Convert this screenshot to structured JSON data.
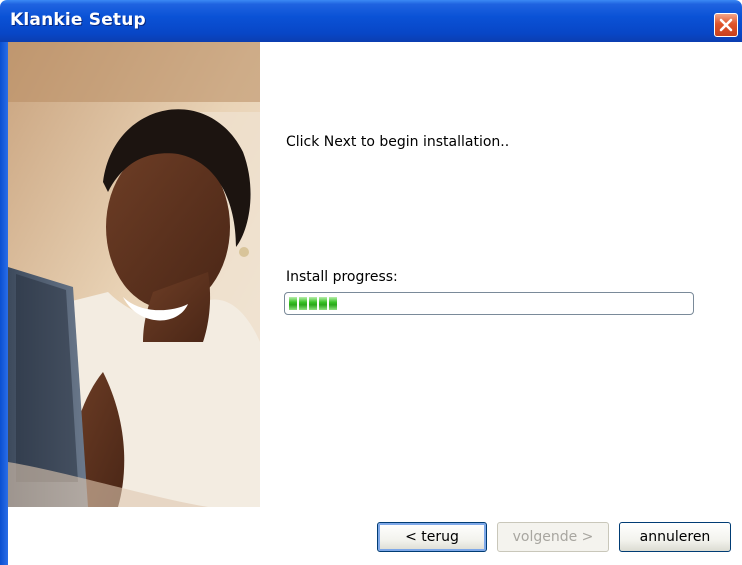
{
  "window": {
    "title": "Klankie Setup"
  },
  "content": {
    "intro_text": "Click Next to begin installation..",
    "progress_label": "Install progress:",
    "progress_fraction": 0.12
  },
  "buttons": {
    "back_label": "< terug",
    "next_label": "volgende >",
    "cancel_label": "annuleren"
  },
  "icons": {
    "close": "close-icon",
    "photo": "woman-at-laptop-photo"
  },
  "colors": {
    "titlebar": "#0a52d6",
    "close_button": "#e0552b",
    "progress": "#39c227"
  }
}
